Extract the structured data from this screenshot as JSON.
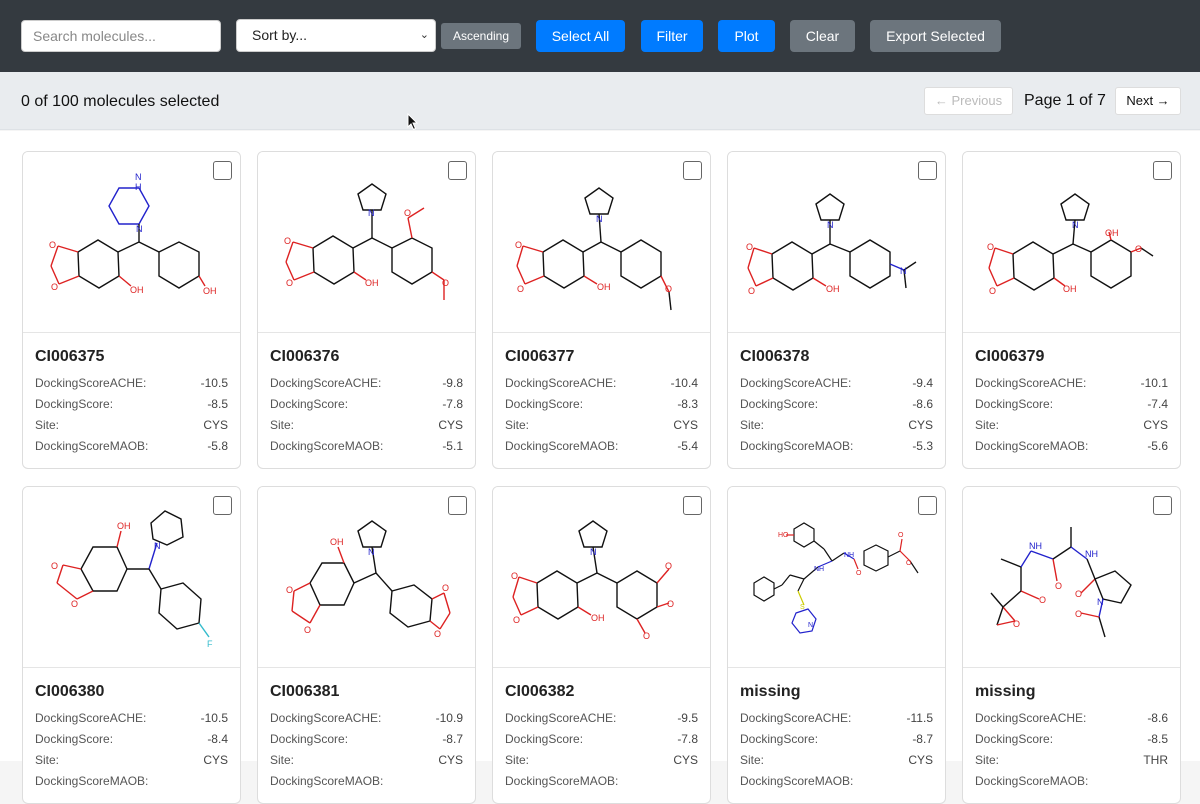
{
  "toolbar": {
    "search_placeholder": "Search molecules...",
    "sort_label": "Sort by...",
    "ascending_label": "Ascending",
    "select_all_label": "Select All",
    "filter_label": "Filter",
    "plot_label": "Plot",
    "clear_label": "Clear",
    "export_label": "Export Selected"
  },
  "status": {
    "selected_text": "0 of 100 molecules selected",
    "prev_label": "← Previous",
    "page_text": "Page 1 of 7",
    "next_label": "Next →"
  },
  "property_labels": {
    "ache": "DockingScoreACHE:",
    "score": "DockingScore:",
    "site": "Site:",
    "maob": "DockingScoreMAOB:"
  },
  "molecules": [
    {
      "name": "CI006375",
      "ache": "-10.5",
      "score": "-8.5",
      "site": "CYS",
      "maob": "-5.8"
    },
    {
      "name": "CI006376",
      "ache": "-9.8",
      "score": "-7.8",
      "site": "CYS",
      "maob": "-5.1"
    },
    {
      "name": "CI006377",
      "ache": "-10.4",
      "score": "-8.3",
      "site": "CYS",
      "maob": "-5.4"
    },
    {
      "name": "CI006378",
      "ache": "-9.4",
      "score": "-8.6",
      "site": "CYS",
      "maob": "-5.3"
    },
    {
      "name": "CI006379",
      "ache": "-10.1",
      "score": "-7.4",
      "site": "CYS",
      "maob": "-5.6"
    },
    {
      "name": "CI006380",
      "ache": "-10.5",
      "score": "-8.4",
      "site": "CYS",
      "maob": ""
    },
    {
      "name": "CI006381",
      "ache": "-10.9",
      "score": "-8.7",
      "site": "CYS",
      "maob": ""
    },
    {
      "name": "CI006382",
      "ache": "-9.5",
      "score": "-7.8",
      "site": "CYS",
      "maob": ""
    },
    {
      "name": "missing",
      "ache": "-11.5",
      "score": "-8.7",
      "site": "CYS",
      "maob": ""
    },
    {
      "name": "missing",
      "ache": "-8.6",
      "score": "-8.5",
      "site": "THR",
      "maob": ""
    }
  ]
}
